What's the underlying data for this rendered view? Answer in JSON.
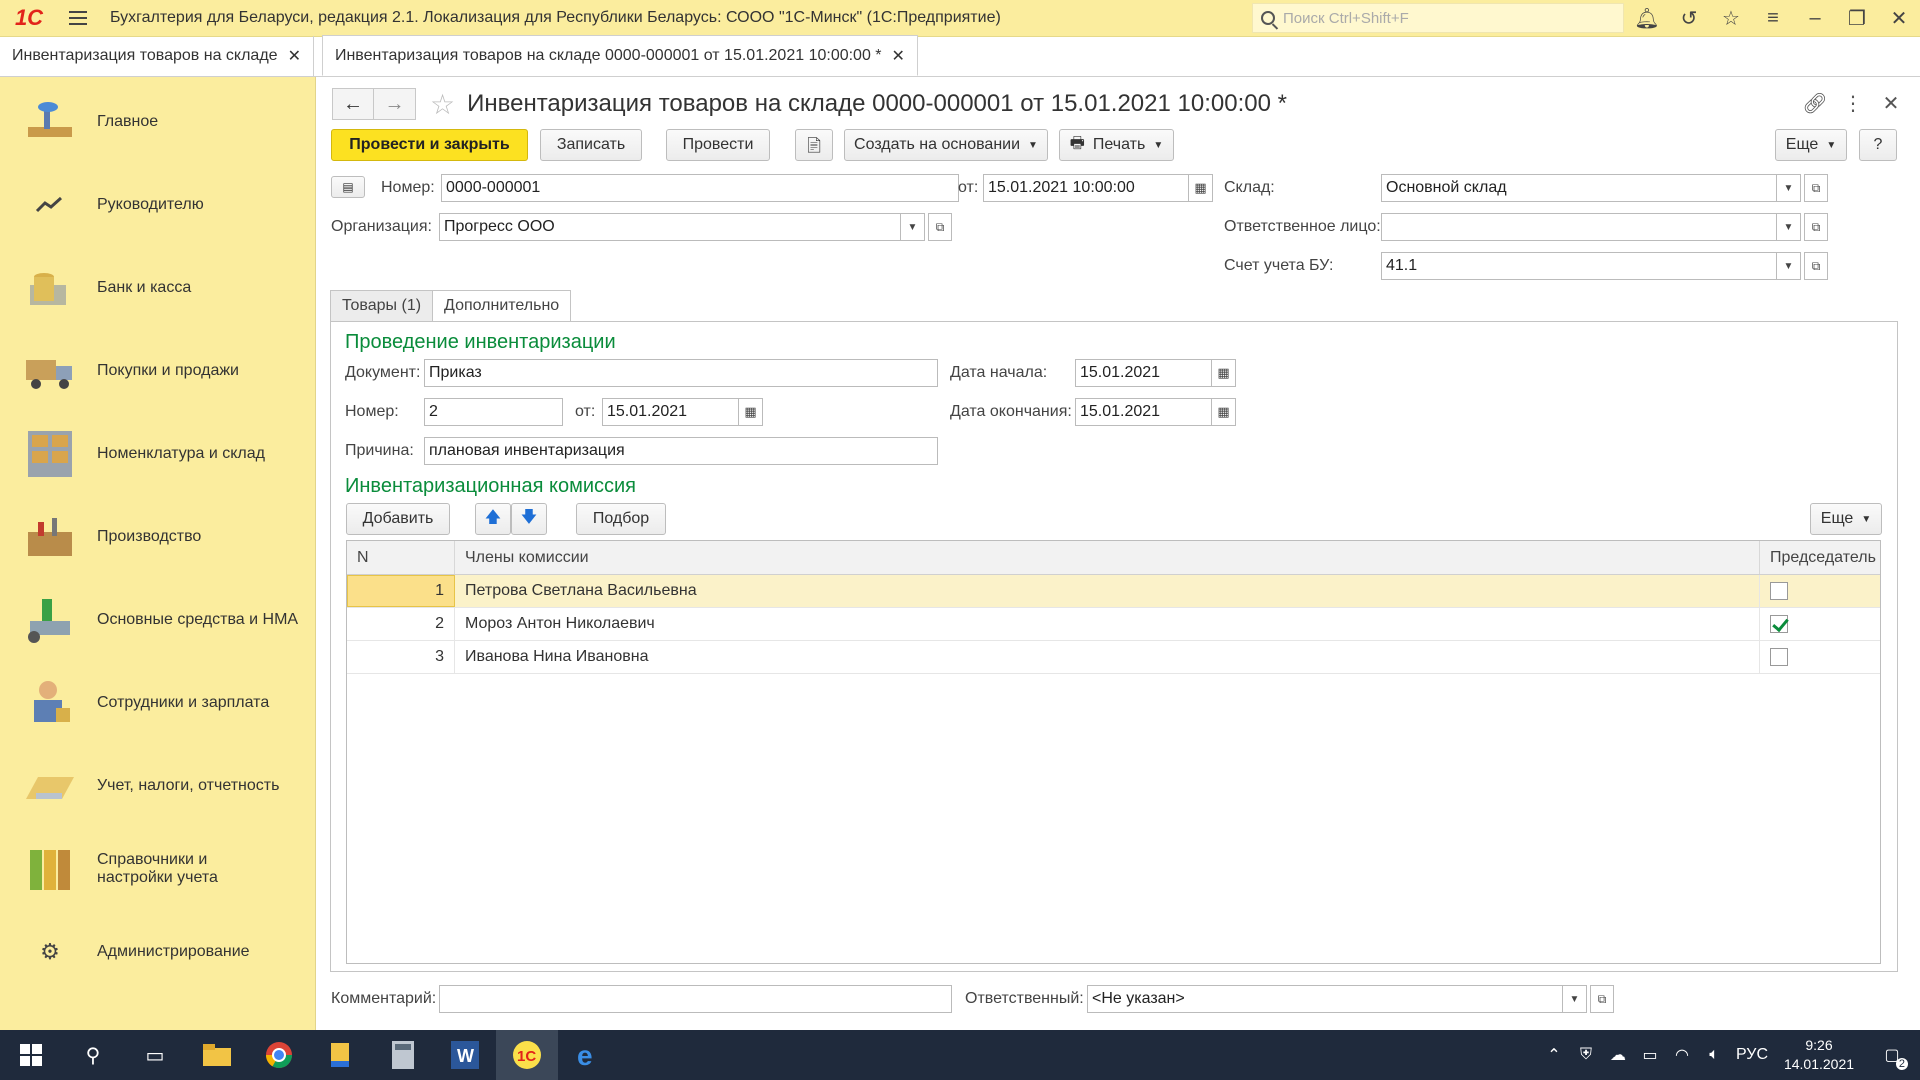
{
  "titlebar": {
    "logo": "1С",
    "title": "Бухгалтерия для Беларуси, редакция 2.1. Локализация для Республики Беларусь: СООО \"1С-Минск\"  (1С:Предприятие)",
    "search_placeholder": "Поиск Ctrl+Shift+F"
  },
  "tabs": [
    {
      "label": "Инвентаризация товаров на складе"
    },
    {
      "label": "Инвентаризация товаров на складе 0000-000001 от 15.01.2021 10:00:00 *"
    }
  ],
  "sidebar": {
    "items": [
      {
        "label": "Главное"
      },
      {
        "label": "Руководителю"
      },
      {
        "label": "Банк и касса"
      },
      {
        "label": "Покупки и продажи"
      },
      {
        "label": "Номенклатура и склад"
      },
      {
        "label": "Производство"
      },
      {
        "label": "Основные средства и НМА"
      },
      {
        "label": "Сотрудники и зарплата"
      },
      {
        "label": "Учет, налоги, отчетность"
      },
      {
        "label": "Справочники и настройки учета"
      },
      {
        "label": "Администрирование"
      }
    ]
  },
  "form": {
    "title": "Инвентаризация товаров на складе 0000-000001 от 15.01.2021 10:00:00 *",
    "toolbar": {
      "post_close": "Провести и закрыть",
      "save": "Записать",
      "post": "Провести",
      "create_based": "Создать на основании",
      "print": "Печать",
      "more": "Еще",
      "help": "?"
    },
    "header": {
      "number_label": "Номер:",
      "number_value": "0000-000001",
      "from_label": "от:",
      "date_value": "15.01.2021 10:00:00",
      "warehouse_label": "Склад:",
      "warehouse_value": "Основной склад",
      "org_label": "Организация:",
      "org_value": "Прогресс ООО",
      "responsible_person_label": "Ответственное лицо:",
      "responsible_person_value": "",
      "account_label": "Счет учета БУ:",
      "account_value": "41.1"
    },
    "doc_tabs": [
      {
        "label": "Товары (1)"
      },
      {
        "label": "Дополнительно"
      }
    ],
    "inventory": {
      "section_title": "Проведение инвентаризации",
      "doc_label": "Документ:",
      "doc_value": "Приказ",
      "num_label": "Номер:",
      "num_value": "2",
      "from_label": "от:",
      "from_value": "15.01.2021",
      "reason_label": "Причина:",
      "reason_value": "плановая инвентаризация",
      "start_label": "Дата начала:",
      "start_value": "15.01.2021",
      "end_label": "Дата окончания:",
      "end_value": "15.01.2021"
    },
    "commission": {
      "section_title": "Инвентаризационная комиссия",
      "add": "Добавить",
      "pick": "Подбор",
      "more": "Еще",
      "columns": {
        "n": "N",
        "name": "Члены комиссии",
        "chair": "Председатель"
      },
      "rows": [
        {
          "n": "1",
          "name": "Петрова Светлана Васильевна",
          "chair": false
        },
        {
          "n": "2",
          "name": "Мороз Антон Николаевич",
          "chair": true
        },
        {
          "n": "3",
          "name": "Иванова Нина Ивановна",
          "chair": false
        }
      ]
    },
    "footer": {
      "comment_label": "Комментарий:",
      "comment_value": "",
      "responsible_label": "Ответственный:",
      "responsible_value": "<Не указан>"
    }
  },
  "taskbar": {
    "lang": "РУС",
    "time": "9:26",
    "date": "14.01.2021",
    "notifications": "2"
  },
  "colors": {
    "accent_yellow": "#fce121",
    "sidebar_bg": "#fbed9e",
    "section_green": "#0a8c3b",
    "taskbar_bg": "#1f2a3c"
  }
}
